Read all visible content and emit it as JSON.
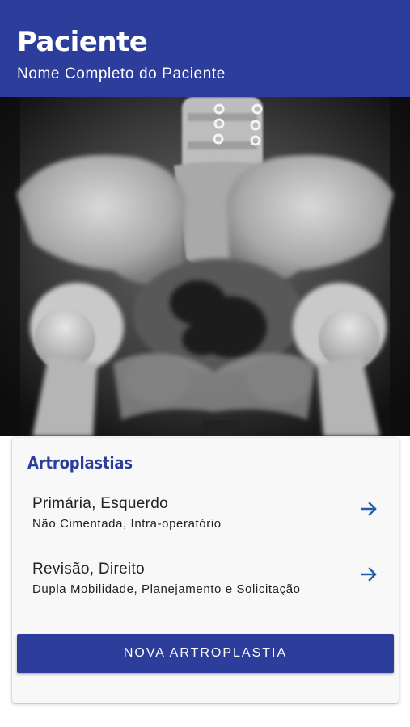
{
  "header": {
    "title": "Paciente",
    "subtitle": "Nome Completo do Paciente"
  },
  "image": {
    "icon": "pelvis-xray-image"
  },
  "card": {
    "section_title": "Artroplastias",
    "items": [
      {
        "title": "Primária, Esquerdo",
        "subtitle": "Não Cimentada, Intra-operatório",
        "icon": "arrow-right-icon"
      },
      {
        "title": "Revisão, Direito",
        "subtitle": "Dupla Mobilidade, Planejamento e Solicitação",
        "icon": "arrow-right-icon"
      }
    ],
    "button_label": "NOVA ARTROPLASTIA"
  },
  "colors": {
    "primary": "#2d3d9c",
    "accent_arrow": "#1f5fa8",
    "card_bg": "#f8f8f8"
  }
}
